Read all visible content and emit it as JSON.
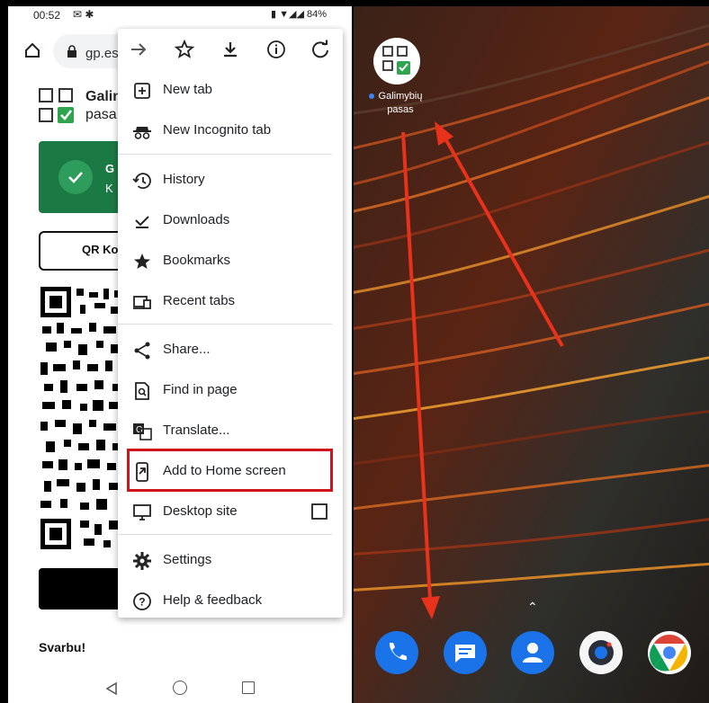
{
  "status_bar": {
    "time": "00:52",
    "battery": "84%"
  },
  "browser": {
    "url": "gp.es",
    "toolbar_icons": [
      "forward-icon",
      "star-icon",
      "download-icon",
      "info-icon",
      "refresh-icon"
    ]
  },
  "page": {
    "title": "Galin",
    "subtitle": "pasa",
    "card_title": "G",
    "card_sub": "K",
    "qr_button": "QR Ko",
    "footer_text": "Svarbu!"
  },
  "menu": {
    "items": [
      {
        "label": "New tab",
        "icon": "new-tab-icon"
      },
      {
        "label": "New Incognito tab",
        "icon": "incognito-icon"
      },
      {
        "label": "History",
        "icon": "history-icon"
      },
      {
        "label": "Downloads",
        "icon": "downloads-icon"
      },
      {
        "label": "Bookmarks",
        "icon": "bookmarks-icon"
      },
      {
        "label": "Recent tabs",
        "icon": "recent-tabs-icon"
      },
      {
        "label": "Share...",
        "icon": "share-icon"
      },
      {
        "label": "Find in page",
        "icon": "find-icon"
      },
      {
        "label": "Translate...",
        "icon": "translate-icon"
      },
      {
        "label": "Add to Home screen",
        "icon": "add-to-home-icon"
      },
      {
        "label": "Desktop site",
        "icon": "desktop-icon"
      },
      {
        "label": "Settings",
        "icon": "settings-icon"
      },
      {
        "label": "Help & feedback",
        "icon": "help-icon"
      }
    ],
    "highlighted": "Add to Home screen",
    "highlight_color": "#d0141b"
  },
  "home_screen": {
    "app_label_line1": "Galimybių",
    "app_label_line2": "pasas",
    "dock": [
      "phone-icon",
      "messages-icon",
      "contacts-icon",
      "camera-icon",
      "chrome-icon"
    ],
    "arrow_color": "#e8321c"
  }
}
